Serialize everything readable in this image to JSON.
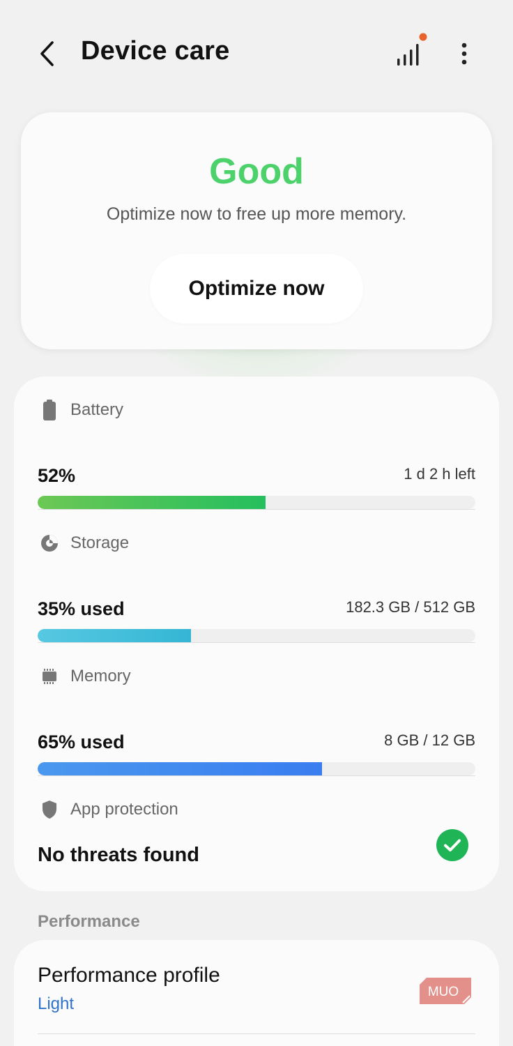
{
  "header": {
    "title": "Device care",
    "back_icon": "chevron-left-icon",
    "signal_icon": "signal-bars-icon",
    "more_icon": "more-vertical-icon",
    "notification_dot_color": "#e8622c"
  },
  "status": {
    "word": "Good",
    "subtitle": "Optimize now to free up more memory.",
    "button_label": "Optimize now",
    "accent_color": "#4cd16b"
  },
  "battery": {
    "label": "Battery",
    "icon": "battery-icon",
    "value": "52%",
    "detail": "1 d 2 h left",
    "percent": 52,
    "color": "#3cc35c"
  },
  "storage": {
    "label": "Storage",
    "icon": "pie-chart-icon",
    "value": "35% used",
    "detail": "182.3 GB / 512 GB",
    "percent": 35,
    "color": "#44bfd9"
  },
  "memory": {
    "label": "Memory",
    "icon": "memory-chip-icon",
    "value": "65% used",
    "detail": "8 GB / 12 GB",
    "percent": 65,
    "color": "#3a82f0"
  },
  "app_protection": {
    "label": "App protection",
    "icon": "shield-icon",
    "value": "No threats found",
    "status_icon": "check-circle-icon",
    "status_color": "#1fb455"
  },
  "performance": {
    "section_label": "Performance",
    "profile_title": "Performance profile",
    "profile_value": "Light",
    "logo_text": "MUO"
  }
}
